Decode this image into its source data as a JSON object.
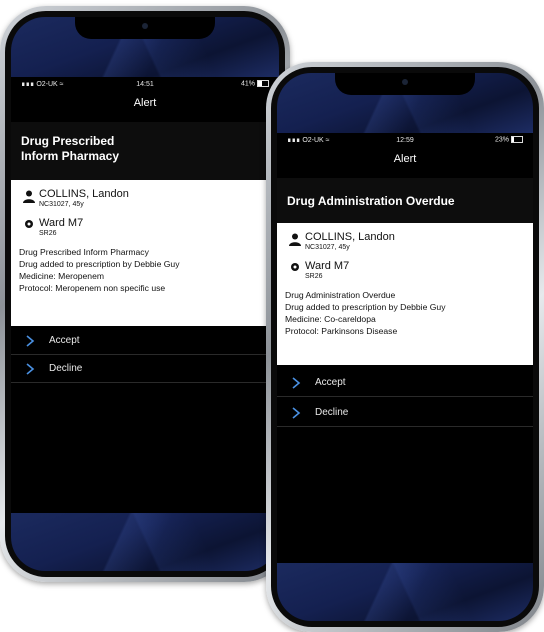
{
  "phone1": {
    "status": {
      "carrier": "O2-UK",
      "time": "14:51",
      "battery": "41%",
      "battery_level": 0.41
    },
    "nav_title": "Alert",
    "header": [
      "Drug Prescribed",
      "Inform Pharmacy"
    ],
    "patient": {
      "name": "COLLINS, Landon",
      "id": "NC31027, 45y"
    },
    "ward": {
      "name": "Ward M7",
      "bed": "SR26"
    },
    "details": [
      "Drug Prescribed Inform Pharmacy",
      "Drug added to prescription by Debbie Guy",
      "Medicine: Meropenem",
      "Protocol: Meropenem non specific use"
    ],
    "actions": {
      "accept": "Accept",
      "decline": "Decline"
    }
  },
  "phone2": {
    "status": {
      "carrier": "O2-UK",
      "time": "12:59",
      "battery": "23%",
      "battery_level": 0.23
    },
    "nav_title": "Alert",
    "header": "Drug Administration Overdue",
    "patient": {
      "name": "COLLINS, Landon",
      "id": "NC31027, 45y"
    },
    "ward": {
      "name": "Ward M7",
      "bed": "SR26"
    },
    "details": [
      "Drug Administration Overdue",
      "Drug added to prescription by Debbie Guy",
      "Medicine: Co-careldopa",
      "Protocol: Parkinsons Disease"
    ],
    "actions": {
      "accept": "Accept",
      "decline": "Decline"
    }
  },
  "colors": {
    "accent_chevron": "#4a90e2",
    "wallpaper": "#142050",
    "card": "#ffffff",
    "screen": "#000000"
  },
  "icons": {
    "person": "person-icon",
    "ward": "ward-icon",
    "chevron": "chevron-right-icon"
  }
}
